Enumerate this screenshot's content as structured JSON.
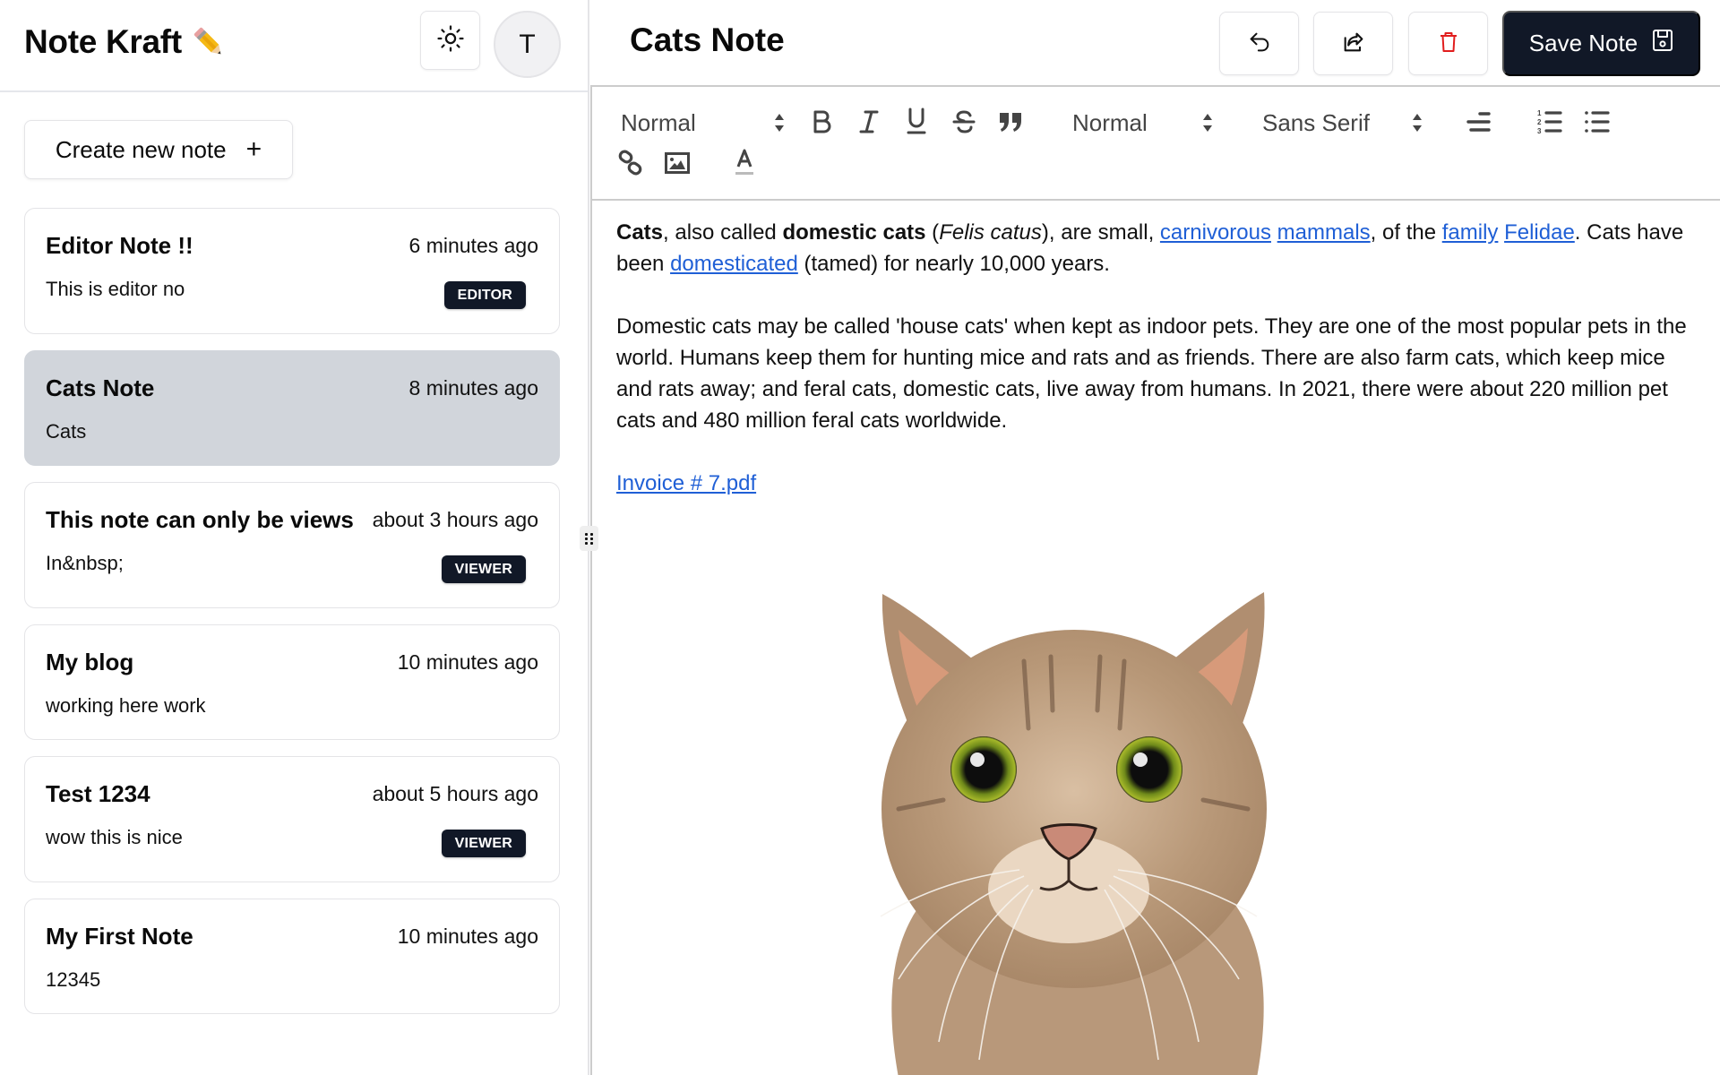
{
  "app": {
    "title": "Note Kraft",
    "title_icon": "pencil-icon",
    "theme_toggle_icon": "sun-icon",
    "avatar_initial": "T"
  },
  "sidebar": {
    "create_button": {
      "label": "Create new note",
      "icon": "plus-icon",
      "icon_glyph": "+"
    },
    "notes": [
      {
        "title": "Editor Note !!",
        "time": "6 minutes ago",
        "excerpt": "This is editor no",
        "badge": "EDITOR",
        "selected": false
      },
      {
        "title": "Cats Note",
        "time": "8 minutes ago",
        "excerpt": "Cats",
        "badge": null,
        "selected": true
      },
      {
        "title": "This note can only be views",
        "time": "about 3 hours ago",
        "excerpt": "In&nbsp;",
        "badge": "VIEWER",
        "selected": false
      },
      {
        "title": "My blog",
        "time": "10 minutes ago",
        "excerpt": "working here work",
        "badge": null,
        "selected": false
      },
      {
        "title": "Test 1234",
        "time": "about 5 hours ago",
        "excerpt": "wow this is nice",
        "badge": "VIEWER",
        "selected": false
      },
      {
        "title": "My First Note",
        "time": "10 minutes ago",
        "excerpt": "12345",
        "badge": null,
        "selected": false
      }
    ]
  },
  "main": {
    "heading": "Cats Note",
    "actions": {
      "undo_icon": "undo-icon",
      "share_icon": "share-icon",
      "delete_icon": "trash-icon",
      "save_label": "Save Note",
      "save_icon": "floppy-disk-icon"
    },
    "toolbar": {
      "header_picker": "Normal",
      "size_picker": "Normal",
      "font_picker": "Sans Serif",
      "buttons": [
        "bold",
        "italic",
        "underline",
        "strike",
        "blockquote",
        "align-right",
        "ordered-list",
        "bullet-list",
        "link",
        "image",
        "text-color"
      ]
    },
    "content": {
      "p1": {
        "b1": "Cats",
        "t1": ", also called ",
        "b2": "domestic cats",
        "t2": " (",
        "i1": "Felis catus",
        "t3": "), are small, ",
        "l1": "carnivorous",
        "t4": " ",
        "l2": "mammals",
        "t5": ", of the ",
        "l3": "family",
        "t6": " ",
        "l4": "Felidae",
        "t7": ". Cats have been ",
        "l5": "domesticated",
        "t8": " (tamed) for nearly 10,000 years."
      },
      "p2": "Domestic cats may be called 'house cats' when kept as indoor pets. They are one of the most popular pets in the world. Humans keep them for hunting mice and rats and as friends. There are also farm cats, which keep mice and rats away; and feral cats, domestic cats, live away from humans. In 2021, there were about 220 million pet cats and 480 million feral cats worldwide.",
      "attachment_link": "Invoice # 7.pdf",
      "image_alt": "tabby kitten face"
    }
  },
  "colors": {
    "primary_dark": "#111827",
    "selected_card": "#d1d5db",
    "link": "#1f5fd6",
    "delete_red": "#e11d1d"
  }
}
